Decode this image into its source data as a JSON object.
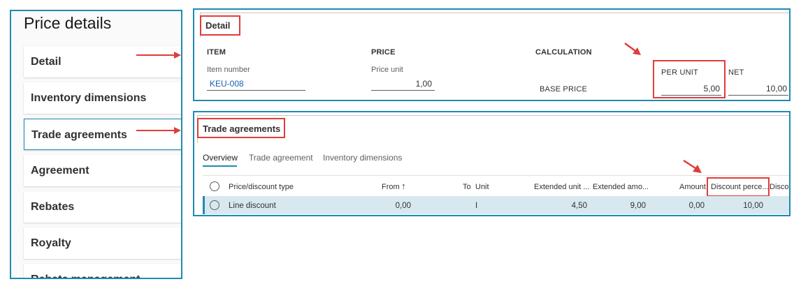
{
  "left_panel": {
    "title": "Price details",
    "items": [
      {
        "label": "Detail"
      },
      {
        "label": "Inventory dimensions"
      },
      {
        "label": "Trade agreements"
      },
      {
        "label": "Agreement"
      },
      {
        "label": "Rebates"
      },
      {
        "label": "Royalty"
      },
      {
        "label": "Rebate management"
      }
    ]
  },
  "detail": {
    "title": "Detail",
    "item_header": "ITEM",
    "price_header": "PRICE",
    "calculation_header": "CALCULATION",
    "item_number_label": "Item number",
    "item_number_value": "KEU-008",
    "price_unit_label": "Price unit",
    "price_unit_value": "1,00",
    "base_price_label": "BASE PRICE",
    "per_unit_header": "PER UNIT",
    "net_header": "NET",
    "per_unit_value": "5,00",
    "net_value": "10,00"
  },
  "trade": {
    "title": "Trade agreements",
    "tabs": [
      "Overview",
      "Trade agreement",
      "Inventory dimensions"
    ],
    "columns": {
      "type": "Price/discount type",
      "from": "From",
      "sort_arrow": "↑",
      "to": "To",
      "unit": "Unit",
      "ext_unit": "Extended unit ...",
      "ext_amount": "Extended amo...",
      "amount": "Amount",
      "discount_percent": "Discount perce...",
      "discount_more": "Discou"
    },
    "row": {
      "type": "Line discount",
      "from": "0,00",
      "unit": "I",
      "ext_unit": "4,50",
      "ext_amount": "9,00",
      "amount": "0,00",
      "discount_percent": "10,00"
    }
  },
  "colors": {
    "panel_border": "#1e8bb0",
    "highlight_red": "#e03c3c",
    "link_blue": "#1a5fb4",
    "selected_row": "#d7e9ef"
  }
}
